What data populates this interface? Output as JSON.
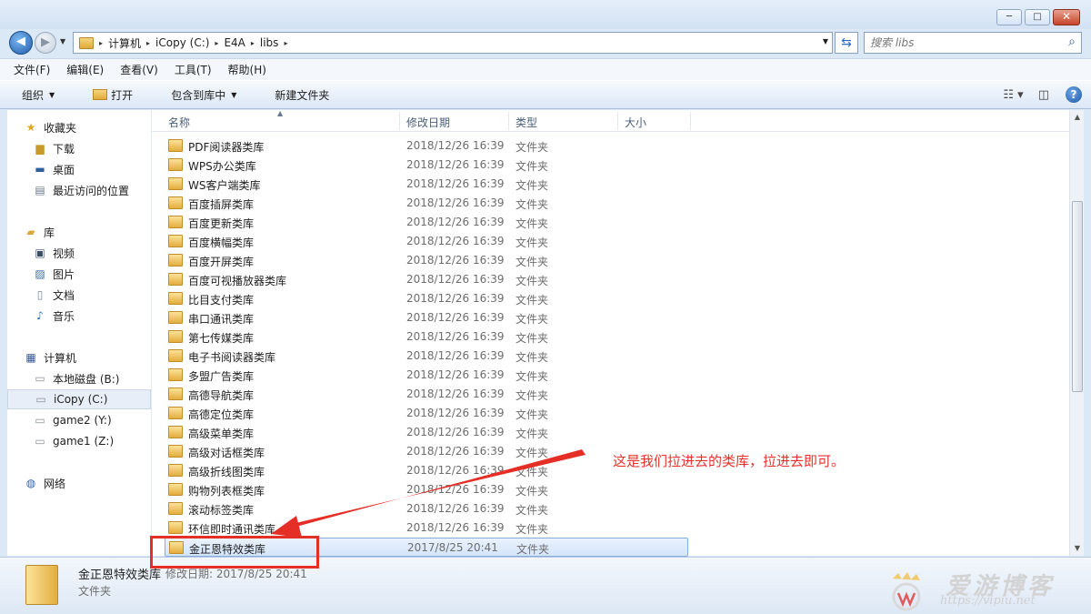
{
  "window": {
    "minimize_glyph": "─",
    "maximize_glyph": "□",
    "close_glyph": "✕"
  },
  "address": {
    "segments": [
      "计算机",
      "iCopy (C:)",
      "E4A",
      "libs"
    ],
    "separator_glyph": "▸"
  },
  "search": {
    "placeholder": "搜索 libs"
  },
  "menu": [
    "文件(F)",
    "编辑(E)",
    "查看(V)",
    "工具(T)",
    "帮助(H)"
  ],
  "toolbar": {
    "organize": "组织",
    "open": "打开",
    "include_in_library": "包含到库中",
    "new_folder": "新建文件夹"
  },
  "nav": {
    "favorites": "收藏夹",
    "downloads": "下载",
    "desktop": "桌面",
    "recent": "最近访问的位置",
    "libraries": "库",
    "videos": "视频",
    "pictures": "图片",
    "documents": "文档",
    "music": "音乐",
    "computer": "计算机",
    "drive_b": "本地磁盘 (B:)",
    "drive_c": "iCopy (C:)",
    "drive_y": "game2 (Y:)",
    "drive_z": "game1 (Z:)",
    "network": "网络"
  },
  "columns": {
    "name": "名称",
    "date": "修改日期",
    "type": "类型",
    "size": "大小"
  },
  "files": [
    {
      "name": "PDF阅读器类库",
      "date": "2018/12/26 16:39",
      "type": "文件夹"
    },
    {
      "name": "WPS办公类库",
      "date": "2018/12/26 16:39",
      "type": "文件夹"
    },
    {
      "name": "WS客户端类库",
      "date": "2018/12/26 16:39",
      "type": "文件夹"
    },
    {
      "name": "百度插屏类库",
      "date": "2018/12/26 16:39",
      "type": "文件夹"
    },
    {
      "name": "百度更新类库",
      "date": "2018/12/26 16:39",
      "type": "文件夹"
    },
    {
      "name": "百度横幅类库",
      "date": "2018/12/26 16:39",
      "type": "文件夹"
    },
    {
      "name": "百度开屏类库",
      "date": "2018/12/26 16:39",
      "type": "文件夹"
    },
    {
      "name": "百度可视播放器类库",
      "date": "2018/12/26 16:39",
      "type": "文件夹"
    },
    {
      "name": "比目支付类库",
      "date": "2018/12/26 16:39",
      "type": "文件夹"
    },
    {
      "name": "串口通讯类库",
      "date": "2018/12/26 16:39",
      "type": "文件夹"
    },
    {
      "name": "第七传媒类库",
      "date": "2018/12/26 16:39",
      "type": "文件夹"
    },
    {
      "name": "电子书阅读器类库",
      "date": "2018/12/26 16:39",
      "type": "文件夹"
    },
    {
      "name": "多盟广告类库",
      "date": "2018/12/26 16:39",
      "type": "文件夹"
    },
    {
      "name": "高德导航类库",
      "date": "2018/12/26 16:39",
      "type": "文件夹"
    },
    {
      "name": "高德定位类库",
      "date": "2018/12/26 16:39",
      "type": "文件夹"
    },
    {
      "name": "高级菜单类库",
      "date": "2018/12/26 16:39",
      "type": "文件夹"
    },
    {
      "name": "高级对话框类库",
      "date": "2018/12/26 16:39",
      "type": "文件夹"
    },
    {
      "name": "高级折线图类库",
      "date": "2018/12/26 16:39",
      "type": "文件夹"
    },
    {
      "name": "购物列表框类库",
      "date": "2018/12/26 16:39",
      "type": "文件夹"
    },
    {
      "name": "滚动标签类库",
      "date": "2018/12/26 16:39",
      "type": "文件夹"
    },
    {
      "name": "环信即时通讯类库",
      "date": "2018/12/26 16:39",
      "type": "文件夹"
    },
    {
      "name": "金正恩特效类库",
      "date": "2017/8/25 20:41",
      "type": "文件夹",
      "selected": true
    }
  ],
  "details": {
    "name": "金正恩特效类库",
    "modified": "修改日期: 2017/8/25 20:41",
    "type": "文件夹"
  },
  "annotation": {
    "text": "这是我们拉进去的类库，拉进去即可。",
    "color": "#e8312b"
  },
  "watermark": {
    "title": "爱游博客",
    "url": "https://vipiu.net"
  }
}
